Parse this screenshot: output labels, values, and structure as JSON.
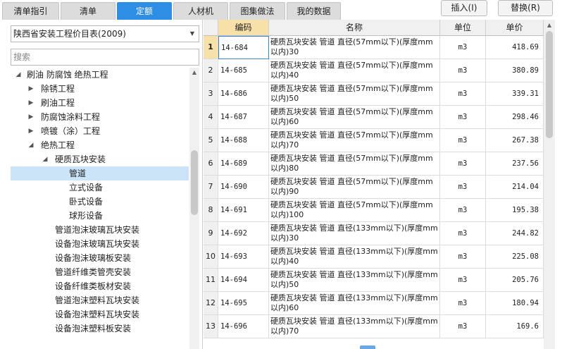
{
  "tabs": [
    {
      "label": "清单指引",
      "active": false
    },
    {
      "label": "清单",
      "active": false
    },
    {
      "label": "定额",
      "active": true
    },
    {
      "label": "人材机",
      "active": false
    },
    {
      "label": "图集做法",
      "active": false
    },
    {
      "label": "我的数据",
      "active": false
    }
  ],
  "toolbar": {
    "insert_label": "插入(I)",
    "replace_label": "替换(R)"
  },
  "left_panel": {
    "library_select": "陕西省安装工程价目表(2009)",
    "search_placeholder": "搜索"
  },
  "tree": [
    {
      "label": "刷油 防腐蚀 绝热工程",
      "level": 0,
      "state": "expanded"
    },
    {
      "label": "除锈工程",
      "level": 1,
      "state": "collapsed"
    },
    {
      "label": "刷油工程",
      "level": 1,
      "state": "collapsed"
    },
    {
      "label": "防腐蚀涂料工程",
      "level": 1,
      "state": "collapsed"
    },
    {
      "label": "喷镀（涂）工程",
      "level": 1,
      "state": "collapsed"
    },
    {
      "label": "绝热工程",
      "level": 1,
      "state": "expanded"
    },
    {
      "label": "硬质瓦块安装",
      "level": 2,
      "state": "expanded"
    },
    {
      "label": "管道",
      "level": 3,
      "state": "leaf",
      "selected": true
    },
    {
      "label": "立式设备",
      "level": 3,
      "state": "leaf"
    },
    {
      "label": "卧式设备",
      "level": 3,
      "state": "leaf"
    },
    {
      "label": "球形设备",
      "level": 3,
      "state": "leaf"
    },
    {
      "label": "管道泡沫玻璃瓦块安装",
      "level": 2,
      "state": "leaf"
    },
    {
      "label": "设备泡沫玻璃瓦块安装",
      "level": 2,
      "state": "leaf"
    },
    {
      "label": "设备泡沫玻璃板安装",
      "level": 2,
      "state": "leaf"
    },
    {
      "label": "管道纤维类管壳安装",
      "level": 2,
      "state": "leaf"
    },
    {
      "label": "设备纤维类板材安装",
      "level": 2,
      "state": "leaf"
    },
    {
      "label": "管道泡沫塑料瓦块安装",
      "level": 2,
      "state": "leaf"
    },
    {
      "label": "设备泡沫塑料瓦块安装",
      "level": 2,
      "state": "leaf"
    },
    {
      "label": "设备泡沫塑料板安装",
      "level": 2,
      "state": "leaf"
    }
  ],
  "grid": {
    "columns": [
      "编码",
      "名称",
      "单位",
      "单价"
    ],
    "rows": [
      {
        "idx": "1",
        "code": "14-684",
        "name": "硬质瓦块安装 管道 直径(57mm以下)(厚度mm以内)30",
        "unit": "m3",
        "price": "418.69"
      },
      {
        "idx": "2",
        "code": "14-685",
        "name": "硬质瓦块安装 管道 直径(57mm以下)(厚度mm以内)40",
        "unit": "m3",
        "price": "380.89"
      },
      {
        "idx": "3",
        "code": "14-686",
        "name": "硬质瓦块安装 管道 直径(57mm以下)(厚度mm以内)50",
        "unit": "m3",
        "price": "339.31"
      },
      {
        "idx": "4",
        "code": "14-687",
        "name": "硬质瓦块安装 管道 直径(57mm以下)(厚度mm以内)60",
        "unit": "m3",
        "price": "298.46"
      },
      {
        "idx": "5",
        "code": "14-688",
        "name": "硬质瓦块安装 管道 直径(57mm以下)(厚度mm以内)70",
        "unit": "m3",
        "price": "267.38"
      },
      {
        "idx": "6",
        "code": "14-689",
        "name": "硬质瓦块安装 管道 直径(57mm以下)(厚度mm以内)80",
        "unit": "m3",
        "price": "237.56"
      },
      {
        "idx": "7",
        "code": "14-690",
        "name": "硬质瓦块安装 管道 直径(57mm以下)(厚度mm以内)90",
        "unit": "m3",
        "price": "214.04"
      },
      {
        "idx": "8",
        "code": "14-691",
        "name": "硬质瓦块安装 管道 直径(57mm以下)(厚度mm以内)100",
        "unit": "m3",
        "price": "195.38"
      },
      {
        "idx": "9",
        "code": "14-692",
        "name": "硬质瓦块安装 管道 直径(133mm以下)(厚度mm以内)30",
        "unit": "m3",
        "price": "244.82"
      },
      {
        "idx": "10",
        "code": "14-693",
        "name": "硬质瓦块安装 管道 直径(133mm以下)(厚度mm以内)40",
        "unit": "m3",
        "price": "225.08"
      },
      {
        "idx": "11",
        "code": "14-694",
        "name": "硬质瓦块安装 管道 直径(133mm以下)(厚度mm以内)50",
        "unit": "m3",
        "price": "205.76"
      },
      {
        "idx": "12",
        "code": "14-695",
        "name": "硬质瓦块安装 管道 直径(133mm以下)(厚度mm以内)60",
        "unit": "m3",
        "price": "180.94"
      },
      {
        "idx": "13",
        "code": "14-696",
        "name": "硬质瓦块安装 管道 直径(133mm以下)(厚度mm以内)70",
        "unit": "m3",
        "price": "169.6"
      }
    ]
  },
  "colors": {
    "accent": "#2e8ee6",
    "header_highlight": "#f8e1a8",
    "selection": "#cce4f7"
  }
}
